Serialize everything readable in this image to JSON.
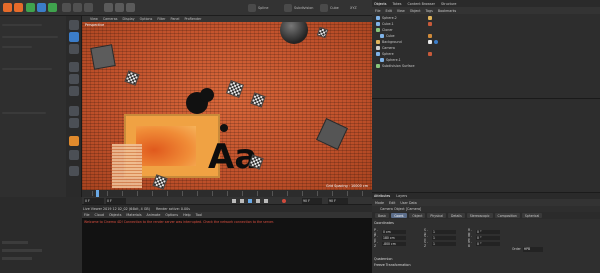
{
  "top_toolbar": {
    "items": [
      {
        "name": "live-selection",
        "label": ""
      },
      {
        "name": "move",
        "label": ""
      },
      {
        "name": "scale",
        "label": ""
      },
      {
        "name": "rotate",
        "label": ""
      },
      {
        "name": "xyz",
        "label": "XYZ"
      },
      {
        "name": "spline",
        "label": "Spline"
      },
      {
        "name": "subdivision",
        "label": "Subdivision"
      },
      {
        "name": "cube-object",
        "label": "Cube"
      }
    ]
  },
  "viewport": {
    "menu": [
      "View",
      "Cameras",
      "Display",
      "Options",
      "Filter",
      "Panel",
      "ProRender"
    ],
    "label": "Perspective",
    "grid_spacing": "Grid Spacing : 10000 cm",
    "accent": "#c9572e"
  },
  "timeline": {
    "ticks": [
      "0",
      "5",
      "10",
      "15",
      "20",
      "25",
      "30",
      "35",
      "40",
      "45",
      "50",
      "55",
      "60",
      "65",
      "70",
      "75",
      "80",
      "85",
      "90"
    ],
    "end_frame": "90 F",
    "start_field": "0 F",
    "current_field": "0 F",
    "end_field": "90 F",
    "max_field": "90 F"
  },
  "picture_viewer": {
    "status": "Live Viewer 2019 12 02_02 (64bit, 4 GB)",
    "status_right": "Render active: 0.00s",
    "menu": [
      "File",
      "Cloud",
      "Objects",
      "Materials",
      "Animate",
      "Options",
      "Help",
      "Tool"
    ],
    "log": "Welcome to Cinema 4D! Connection to the render server was interrupted. Check the network connection to the server."
  },
  "object_manager": {
    "tabs": [
      "Objects",
      "Takes",
      "Content Browser",
      "Structure"
    ],
    "active_tab": "Objects",
    "menu": [
      "File",
      "Edit",
      "View",
      "Object",
      "Tags",
      "Bookmarks"
    ],
    "rows": [
      {
        "name": "Sphere.2",
        "icon_color": "#7fb3e8"
      },
      {
        "name": "Cube.1",
        "icon_color": "#7fb3e8"
      },
      {
        "name": "Cloner",
        "icon_color": "#88c57a"
      },
      {
        "name": "Cube",
        "icon_color": "#7fb3e8"
      },
      {
        "name": "Background",
        "icon_color": "#e0b35a"
      },
      {
        "name": "Camera",
        "icon_color": "#cfcfcf"
      },
      {
        "name": "Sphere",
        "icon_color": "#7fb3e8"
      },
      {
        "name": "Sphere.1",
        "icon_color": "#7fb3e8"
      },
      {
        "name": "Subdivision Surface",
        "icon_color": "#88c57a"
      }
    ]
  },
  "attributes": {
    "tabs": [
      "Attributes",
      "Layers"
    ],
    "menu": [
      "Mode",
      "Edit",
      "User Data"
    ],
    "object_title": "Camera Object [Camera]",
    "subtabs": [
      "Basic",
      "Coord.",
      "Object",
      "Physical",
      "Details",
      "Stereoscopic",
      "Composition",
      "Spherical"
    ],
    "active_subtab": "Coord.",
    "section": "Coordinates",
    "coords": [
      {
        "axis": "P . X",
        "value": "0 cm",
        "axis2": "S . X",
        "value2": "1",
        "axis3": "R . H",
        "value3": "0 °"
      },
      {
        "axis": "P . Y",
        "value": "180 cm",
        "axis2": "S . Y",
        "value2": "1",
        "axis3": "R . P",
        "value3": "0 °"
      },
      {
        "axis": "P . Z",
        "value": "-800 cm",
        "axis2": "S . Z",
        "value2": "1",
        "axis3": "R . B",
        "value3": "0 °"
      }
    ],
    "order_label": "Order",
    "order_value": "HPB",
    "quaternion": "Quaternion",
    "freeze": "Freeze Transformation"
  },
  "colors": {
    "panel": "#2b2b2b",
    "active_tab": "#5b6d8a",
    "viewport_orange": "#c9572e",
    "log_red": "#e05040"
  }
}
